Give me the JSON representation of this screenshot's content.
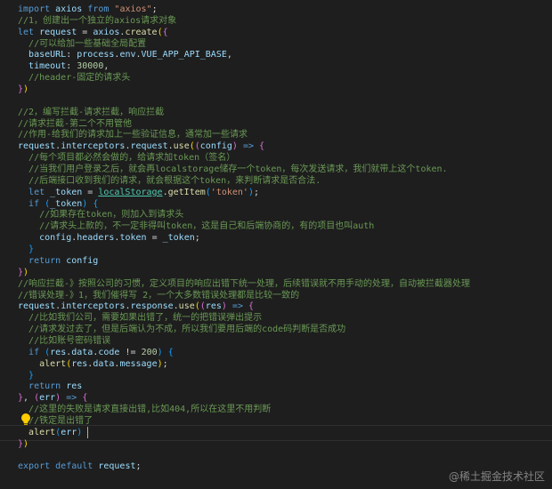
{
  "editor": {
    "theme": {
      "background": "#1e1e1e",
      "keyword": "#569cd6",
      "string": "#ce9178",
      "comment": "#6a9955",
      "variable": "#9cdcfe",
      "function": "#dcdcaa",
      "number": "#b5cea8",
      "class": "#4ec9b0"
    },
    "lines": [
      [
        [
          "k",
          "import"
        ],
        [
          "p",
          " "
        ],
        [
          "v",
          "axios"
        ],
        [
          "p",
          " "
        ],
        [
          "k",
          "from"
        ],
        [
          "p",
          " "
        ],
        [
          "s",
          "\"axios\""
        ],
        [
          "p",
          ";"
        ]
      ],
      [
        [
          "c",
          "//1，创建出一个独立的axios请求对象"
        ]
      ],
      [
        [
          "k",
          "let"
        ],
        [
          "p",
          " "
        ],
        [
          "v",
          "request"
        ],
        [
          "p",
          " = "
        ],
        [
          "v",
          "axios"
        ],
        [
          "p",
          "."
        ],
        [
          "f",
          "create"
        ],
        [
          "b1",
          "("
        ],
        [
          "b2",
          "{"
        ]
      ],
      [
        [
          "p",
          "  "
        ],
        [
          "c",
          "//可以给加一些基础全局配置"
        ]
      ],
      [
        [
          "p",
          "  "
        ],
        [
          "v",
          "baseURL"
        ],
        [
          "p",
          ": "
        ],
        [
          "v",
          "process"
        ],
        [
          "p",
          "."
        ],
        [
          "v",
          "env"
        ],
        [
          "p",
          "."
        ],
        [
          "v",
          "VUE_APP_API_BASE"
        ],
        [
          "p",
          ","
        ]
      ],
      [
        [
          "p",
          "  "
        ],
        [
          "v",
          "timeout"
        ],
        [
          "p",
          ": "
        ],
        [
          "n",
          "30000"
        ],
        [
          "p",
          ","
        ]
      ],
      [
        [
          "p",
          "  "
        ],
        [
          "c",
          "//header-固定的请求头"
        ]
      ],
      [
        [
          "b2",
          "}"
        ],
        [
          "b1",
          ")"
        ]
      ],
      [],
      [
        [
          "c",
          "//2，编写拦截-请求拦截，响应拦截"
        ]
      ],
      [
        [
          "c",
          "//请求拦截-第二个不用管他"
        ]
      ],
      [
        [
          "c",
          "//作用-给我们的请求加上一些验证信息，通常加一些请求"
        ]
      ],
      [
        [
          "v",
          "request"
        ],
        [
          "p",
          "."
        ],
        [
          "v",
          "interceptors"
        ],
        [
          "p",
          "."
        ],
        [
          "v",
          "request"
        ],
        [
          "p",
          "."
        ],
        [
          "f",
          "use"
        ],
        [
          "b1",
          "("
        ],
        [
          "b2",
          "("
        ],
        [
          "v",
          "config"
        ],
        [
          "b2",
          ")"
        ],
        [
          "p",
          " "
        ],
        [
          "k",
          "=>"
        ],
        [
          "p",
          " "
        ],
        [
          "b2",
          "{"
        ]
      ],
      [
        [
          "p",
          "  "
        ],
        [
          "c",
          "//每个项目都必然会做的，给请求加token（签名）"
        ]
      ],
      [
        [
          "p",
          "  "
        ],
        [
          "c",
          "//当我们用户登录之后，就会再localstorage储存一个token，每次发送请求，我们就带上这个token."
        ]
      ],
      [
        [
          "p",
          "  "
        ],
        [
          "c",
          "//后端接口收到我们的请求，就会根据这个token，来判断请求是否合法."
        ]
      ],
      [
        [
          "p",
          "  "
        ],
        [
          "k",
          "let"
        ],
        [
          "p",
          " "
        ],
        [
          "v",
          "_token"
        ],
        [
          "p",
          " = "
        ],
        [
          "cls u",
          "localStorage"
        ],
        [
          "p",
          "."
        ],
        [
          "f",
          "getItem"
        ],
        [
          "b3",
          "("
        ],
        [
          "s",
          "'token'"
        ],
        [
          "b3",
          ")"
        ],
        [
          "p",
          ";"
        ]
      ],
      [
        [
          "p",
          "  "
        ],
        [
          "k",
          "if"
        ],
        [
          "p",
          " "
        ],
        [
          "b3",
          "("
        ],
        [
          "v",
          "_token"
        ],
        [
          "b3",
          ")"
        ],
        [
          "p",
          " "
        ],
        [
          "b3",
          "{"
        ]
      ],
      [
        [
          "p",
          "    "
        ],
        [
          "c",
          "//如果存在token，则加入到请求头"
        ]
      ],
      [
        [
          "p",
          "    "
        ],
        [
          "c",
          "//请求头上款的，不一定非得叫token，这是自己和后端协商的，有的项目也叫auth"
        ]
      ],
      [
        [
          "p",
          "    "
        ],
        [
          "v",
          "config"
        ],
        [
          "p",
          "."
        ],
        [
          "v",
          "headers"
        ],
        [
          "p",
          "."
        ],
        [
          "v",
          "token"
        ],
        [
          "p",
          " = "
        ],
        [
          "v",
          "_token"
        ],
        [
          "p",
          ";"
        ]
      ],
      [
        [
          "p",
          "  "
        ],
        [
          "b3",
          "}"
        ]
      ],
      [
        [
          "p",
          "  "
        ],
        [
          "k",
          "return"
        ],
        [
          "p",
          " "
        ],
        [
          "v",
          "config"
        ]
      ],
      [
        [
          "b2",
          "}"
        ],
        [
          "b1",
          ")"
        ]
      ],
      [
        [
          "c",
          "//响应拦截-》按照公司的习惯，定义项目的响应出错下统一处理，后续错误就不用手动的处理，自动被拦截器处理"
        ]
      ],
      [
        [
          "c",
          "//错误处理-》1，我们催得写 2，一个大多数错误处理都是比较一致的"
        ]
      ],
      [
        [
          "v",
          "request"
        ],
        [
          "p",
          "."
        ],
        [
          "v",
          "interceptors"
        ],
        [
          "p",
          "."
        ],
        [
          "v",
          "response"
        ],
        [
          "p",
          "."
        ],
        [
          "f",
          "use"
        ],
        [
          "b1",
          "("
        ],
        [
          "b2",
          "("
        ],
        [
          "v",
          "res"
        ],
        [
          "b2",
          ")"
        ],
        [
          "p",
          " "
        ],
        [
          "k",
          "=>"
        ],
        [
          "p",
          " "
        ],
        [
          "b2",
          "{"
        ]
      ],
      [
        [
          "p",
          "  "
        ],
        [
          "c",
          "//比如我们公司，需要如果出错了，统一的把错误弹出提示"
        ]
      ],
      [
        [
          "p",
          "  "
        ],
        [
          "c",
          "//请求发过去了，但是后端认为不成，所以我们要用后端的code码判断是否成功"
        ]
      ],
      [
        [
          "p",
          "  "
        ],
        [
          "c",
          "//比如账号密码错误"
        ]
      ],
      [
        [
          "p",
          "  "
        ],
        [
          "k",
          "if"
        ],
        [
          "p",
          " "
        ],
        [
          "b3",
          "("
        ],
        [
          "v",
          "res"
        ],
        [
          "p",
          "."
        ],
        [
          "v",
          "data"
        ],
        [
          "p",
          "."
        ],
        [
          "v",
          "code"
        ],
        [
          "p",
          " != "
        ],
        [
          "n",
          "200"
        ],
        [
          "b3",
          ")"
        ],
        [
          "p",
          " "
        ],
        [
          "b3",
          "{"
        ]
      ],
      [
        [
          "p",
          "    "
        ],
        [
          "f",
          "alert"
        ],
        [
          "b1",
          "("
        ],
        [
          "v",
          "res"
        ],
        [
          "p",
          "."
        ],
        [
          "v",
          "data"
        ],
        [
          "p",
          "."
        ],
        [
          "v",
          "message"
        ],
        [
          "b1",
          ")"
        ],
        [
          "p",
          ";"
        ]
      ],
      [
        [
          "p",
          "  "
        ],
        [
          "b3",
          "}"
        ]
      ],
      [
        [
          "p",
          "  "
        ],
        [
          "k",
          "return"
        ],
        [
          "p",
          " "
        ],
        [
          "v",
          "res"
        ]
      ],
      [
        [
          "b2",
          "}"
        ],
        [
          "p",
          ", "
        ],
        [
          "b2",
          "("
        ],
        [
          "v",
          "err"
        ],
        [
          "b2",
          ")"
        ],
        [
          "p",
          " "
        ],
        [
          "k",
          "=>"
        ],
        [
          "p",
          " "
        ],
        [
          "b2",
          "{"
        ]
      ],
      [
        [
          "p",
          "  "
        ],
        [
          "c",
          "//这里的失败是请求直接出错,比如404,所以在这里不用判断"
        ]
      ],
      [
        [
          "p",
          "  "
        ],
        [
          "c",
          "//铁定是出错了"
        ]
      ],
      [
        [
          "p",
          "  "
        ],
        [
          "f",
          "alert"
        ],
        [
          "b3",
          "("
        ],
        [
          "v",
          "err"
        ],
        [
          "b3",
          ")"
        ]
      ],
      [
        [
          "b2",
          "}"
        ],
        [
          "b1",
          ")"
        ]
      ],
      [],
      [
        [
          "k",
          "export"
        ],
        [
          "p",
          " "
        ],
        [
          "k",
          "default"
        ],
        [
          "p",
          " "
        ],
        [
          "v",
          "request"
        ],
        [
          "p",
          ";"
        ]
      ]
    ]
  },
  "lightbulb_icon": "lightbulb-icon",
  "watermark": "@稀土掘金技术社区"
}
